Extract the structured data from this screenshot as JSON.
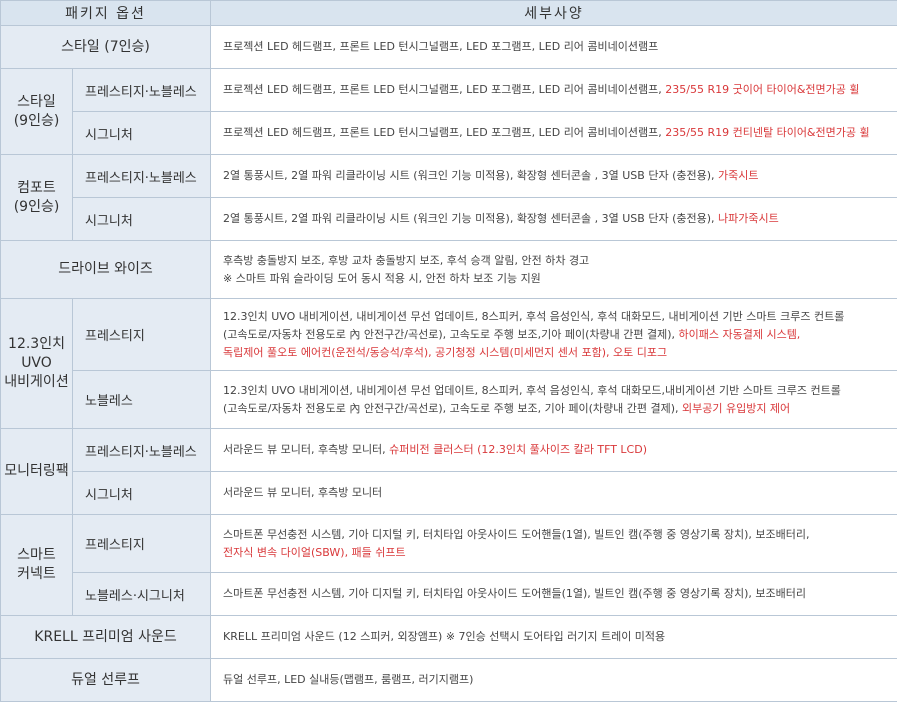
{
  "header": {
    "option": "패키지 옵션",
    "detail": "세부사양"
  },
  "rows": {
    "style7": {
      "label": "스타일 (7인승)",
      "detail": "프로젝션 LED 헤드램프, 프론트 LED 턴시그널램프, LED 포그램프, LED 리어 콤비네이션램프"
    },
    "style9": {
      "label_line1": "스타일",
      "label_line2": "(9인승)",
      "prestige": {
        "label": "프레스티지·노블레스",
        "detail": "프로젝션 LED 헤드램프, 프론트 LED 턴시그널램프, LED 포그램프, LED 리어 콤비네이션램프, ",
        "highlight": "235/55 R19 굿이어 타이어&전면가공 휠"
      },
      "signature": {
        "label": "시그니처",
        "detail": "프로젝션 LED 헤드램프, 프론트 LED 턴시그널램프, LED 포그램프, LED 리어 콤비네이션램프, ",
        "highlight": "235/55 R19 컨티넨탈 타이어&전면가공 휠"
      }
    },
    "comfort9": {
      "label_line1": "컴포트",
      "label_line2": "(9인승)",
      "prestige": {
        "label": "프레스티지·노블레스",
        "detail": "2열 통풍시트, 2열 파워 리클라이닝 시트 (워크인 기능 미적용), 확장형 센터콘솔 , 3열 USB 단자 (충전용), ",
        "highlight": "가죽시트"
      },
      "signature": {
        "label": "시그니처",
        "detail": "2열 통풍시트, 2열 파워 리클라이닝 시트 (워크인 기능 미적용), 확장형 센터콘솔 , 3열 USB 단자 (충전용), ",
        "highlight": "나파가죽시트"
      }
    },
    "drive_wise": {
      "label": "드라이브 와이즈",
      "line1": "후측방 충돌방지 보조, 후방 교차 충돌방지 보조, 후석 승객 알림, 안전 하차 경고",
      "line2": "※ 스마트 파워 슬라이딩 도어 동시 적용 시, 안전 하차 보조 기능 지원"
    },
    "navi": {
      "label_line1": "12.3인치",
      "label_line2": "UVO",
      "label_line3": "내비게이션",
      "prestige": {
        "label": "프레스티지",
        "line1": "12.3인치 UVO 내비게이션, 내비게이션 무선 업데이트, 8스피커, 후석 음성인식, 후석 대화모드, 내비게이션 기반 스마트 크루즈 컨트롤",
        "line2": "(고속도로/자동차 전용도로 內 안전구간/곡선로), 고속도로 주행 보조,기아 페이(차량내 간편 결제), ",
        "line2_highlight": "하이패스 자동결제 시스템,",
        "line3_highlight": "독립제어 풀오토 에어컨(운전석/동승석/후석), 공기청정 시스템(미세먼지 센서 포함), 오토 디포그"
      },
      "noblesse": {
        "label": "노블레스",
        "line1": "12.3인치 UVO 내비게이션, 내비게이션 무선 업데이트, 8스피커, 후석 음성인식, 후석 대화모드,내비게이션 기반 스마트 크루즈 컨트롤",
        "line2": "(고속도로/자동차 전용도로 內 안전구간/곡선로), 고속도로 주행 보조, 기아 페이(차량내 간편 결제), ",
        "line2_highlight": "외부공기 유입방지 제어"
      }
    },
    "monitoring": {
      "label": "모니터링팩",
      "prestige": {
        "label": "프레스티지·노블레스",
        "detail": "서라운드 뷰 모니터, 후측방 모니터, ",
        "highlight": "슈퍼비전 클러스터 (12.3인치 풀사이즈 칼라 TFT LCD)"
      },
      "signature": {
        "label": "시그니처",
        "detail": "서라운드 뷰 모니터, 후측방 모니터"
      }
    },
    "smart": {
      "label_line1": "스마트",
      "label_line2": "커넥트",
      "prestige": {
        "label": "프레스티지",
        "line1": "스마트폰 무선충전 시스템, 기아 디지털 키, 터치타입 아웃사이드 도어핸들(1열), 빌트인 캠(주행 중 영상기록 장치), 보조배터리,",
        "line2_highlight": "전자식 변속 다이얼(SBW), 패들 쉬프트"
      },
      "noblesse": {
        "label": "노블레스·시그니처",
        "detail": "스마트폰 무선충전 시스템, 기아 디지털 키, 터치타입 아웃사이드 도어핸들(1열), 빌트인 캠(주행 중 영상기록 장치), 보조배터리"
      }
    },
    "krell": {
      "label": "KRELL 프리미엄 사운드",
      "detail": "KRELL 프리미엄 사운드 (12 스피커, 외장앰프)   ※ 7인승 선택시 도어타입 러기지 트레이 미적용"
    },
    "sunroof": {
      "label": "듀얼 선루프",
      "detail": "듀얼 선루프, LED 실내등(맵램프, 룸램프, 러기지램프)"
    }
  },
  "colors": {
    "header_bg": "#d9e4ef",
    "label_bg": "#e4ebf3",
    "border": "#b9c7d6",
    "highlight": "#d9383a"
  }
}
